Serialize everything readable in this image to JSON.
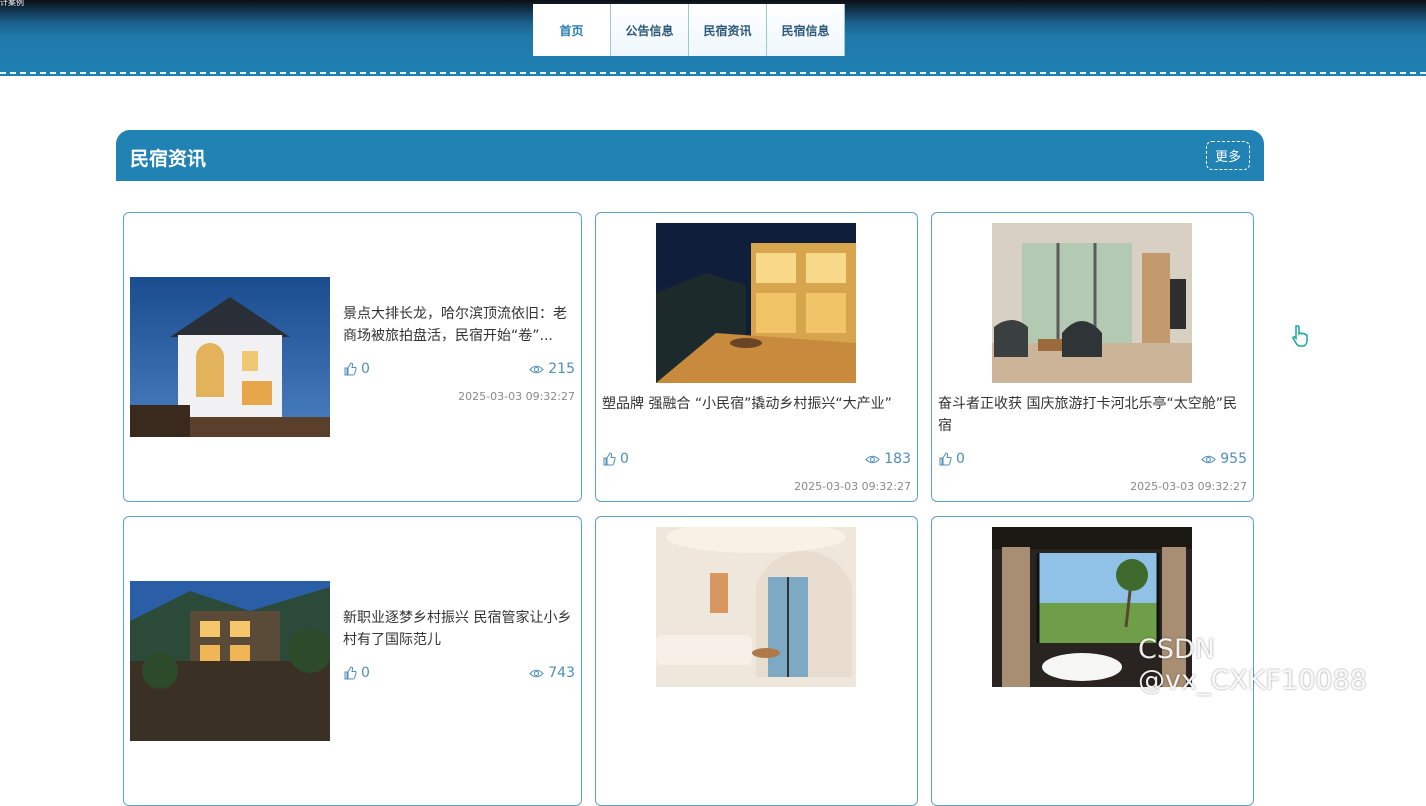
{
  "header": {
    "corner_text": "计案例",
    "nav": [
      {
        "label": "首页",
        "active": true
      },
      {
        "label": "公告信息",
        "active": false
      },
      {
        "label": "民宿资讯",
        "active": false
      },
      {
        "label": "民宿信息",
        "active": false
      }
    ]
  },
  "section": {
    "title": "民宿资讯",
    "more_label": "更多"
  },
  "articles": [
    {
      "title": "景点大排长龙，哈尔滨顶流依旧：老商场被旅拍盘活，民宿开始“卷”...",
      "likes": "0",
      "views": "215",
      "time": "2025-03-03 09:32:27",
      "image": "night-villa-photo"
    },
    {
      "title": "塑品牌 强融合 “小民宿”撬动乡村振兴“大产业”",
      "likes": "0",
      "views": "183",
      "time": "2025-03-03 09:32:27",
      "image": "night-terrace-photo"
    },
    {
      "title": "奋斗者正收获 国庆旅游打卡河北乐亭“太空舱”民宿",
      "likes": "0",
      "views": "955",
      "time": "2025-03-03 09:32:27",
      "image": "living-room-photo"
    },
    {
      "title": "新职业逐梦乡村振兴 民宿管家让小乡村有了国际范儿",
      "likes": "0",
      "views": "743",
      "time": "",
      "image": "mountain-inn-photo"
    },
    {
      "title": "",
      "likes": "",
      "views": "",
      "time": "",
      "image": "white-room-photo"
    },
    {
      "title": "",
      "likes": "",
      "views": "",
      "time": "",
      "image": "bathtub-view-photo"
    }
  ],
  "watermark": "CSDN @vx_CXKF10088",
  "colors": {
    "primary": "#2182b4",
    "card_border": "#5ea3c9",
    "nav_text": "#2d5a7a"
  }
}
